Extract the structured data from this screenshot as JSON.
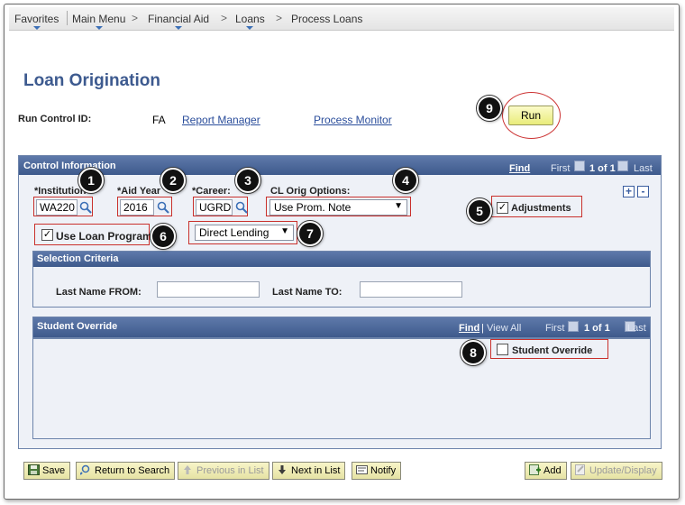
{
  "breadcrumb": {
    "items": [
      "Favorites",
      "Main Menu",
      "Financial Aid",
      "Loans",
      "Process Loans"
    ],
    "separator": ">"
  },
  "page": {
    "title": "Loan Origination",
    "run_control_label": "Run Control ID:",
    "run_control_value": "FA",
    "report_manager_link": "Report Manager",
    "process_monitor_link": "Process Monitor",
    "run_button": "Run"
  },
  "control": {
    "title": "Control Information",
    "find_link": "Find",
    "nav_first": "First",
    "nav_count": "1 of 1",
    "nav_last": "Last",
    "institution_label": "*Institution",
    "institution_value": "WA220",
    "aid_year_label": "*Aid Year",
    "aid_year_value": "2016",
    "career_label": "*Career:",
    "career_value": "UGRD",
    "cl_orig_label": "CL Orig Options:",
    "cl_orig_value": "Use Prom. Note",
    "adjustments_label": "Adjustments",
    "adjustments_checked": true,
    "use_loan_program_label": "Use Loan Program",
    "use_loan_program_checked": true,
    "loan_program_value": "Direct Lending",
    "add_row": "+",
    "delete_row": "-"
  },
  "selection": {
    "title": "Selection Criteria",
    "last_name_from_label": "Last Name FROM:",
    "last_name_from_value": "",
    "last_name_to_label": "Last Name TO:",
    "last_name_to_value": ""
  },
  "override": {
    "title": "Student Override",
    "find_link": "Find",
    "view_all": "View All",
    "sep": "|",
    "nav_first": "First",
    "nav_count": "1 of 1",
    "nav_last": "Last",
    "student_override_label": "Student Override",
    "student_override_checked": false
  },
  "markers": [
    "1",
    "2",
    "3",
    "4",
    "5",
    "6",
    "7",
    "8",
    "9"
  ],
  "toolbar": {
    "save": "Save",
    "return_to_search": "Return to Search",
    "previous_in_list": "Previous in List",
    "next_in_list": "Next in List",
    "notify": "Notify",
    "add": "Add",
    "update_display": "Update/Display"
  },
  "colors": {
    "header_blue": "#3e5a8c",
    "title_blue": "#3d5a8f",
    "marker_red": "#c9302c",
    "button_yellow": "#e6e3a4"
  }
}
